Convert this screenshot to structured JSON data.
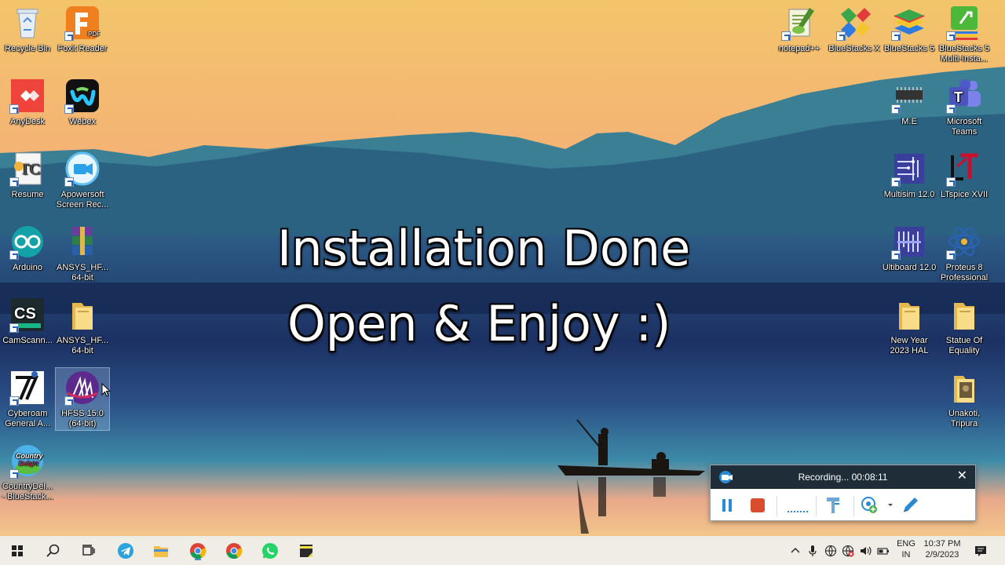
{
  "desktop": {
    "left_icons": [
      {
        "label": "Recycle Bin",
        "icon": "recycle-bin-icon"
      },
      {
        "label": "Foxit Reader",
        "icon": "foxit-reader-icon"
      },
      {
        "label": "AnyDesk",
        "icon": "anydesk-icon"
      },
      {
        "label": "Webex",
        "icon": "webex-icon"
      },
      {
        "label": "Resume",
        "icon": "resume-document-icon"
      },
      {
        "label": "Apowersoft Screen Rec...",
        "icon": "apowersoft-icon"
      },
      {
        "label": "Arduino",
        "icon": "arduino-icon"
      },
      {
        "label": "ANSYS_HF... 64-bit",
        "icon": "winrar-archive-icon"
      },
      {
        "label": "CamScann...",
        "icon": "camscanner-icon"
      },
      {
        "label": "ANSYS_HF... 64-bit",
        "icon": "folder-icon"
      },
      {
        "label": "Cyberoam General A...",
        "icon": "cyberoam-icon"
      },
      {
        "label": "HFSS 15.0 (64-bit)",
        "icon": "hfss-icon"
      },
      {
        "label": "CountryDel... - BlueStack...",
        "icon": "country-delight-icon"
      }
    ],
    "right_icons": [
      {
        "label": "notepad++",
        "icon": "notepad-plus-plus-icon"
      },
      {
        "label": "BlueStacks X",
        "icon": "bluestacks-x-icon"
      },
      {
        "label": "BlueStacks 5",
        "icon": "bluestacks-5-icon"
      },
      {
        "label": "BlueStacks 5 Multi-Insta...",
        "icon": "bluestacks-multi-instance-icon"
      },
      {
        "label": "M.E",
        "icon": "chip-icon"
      },
      {
        "label": "Microsoft Teams",
        "icon": "microsoft-teams-icon"
      },
      {
        "label": "Multisim 12.0",
        "icon": "multisim-icon"
      },
      {
        "label": "LTspice XVII",
        "icon": "ltspice-icon"
      },
      {
        "label": "Ultiboard 12.0",
        "icon": "ultiboard-icon"
      },
      {
        "label": "Proteus 8 Professional",
        "icon": "proteus-icon"
      },
      {
        "label": "New Year 2023 HAL",
        "icon": "folder-icon"
      },
      {
        "label": "Statue Of Equality",
        "icon": "folder-icon"
      },
      {
        "label": "Unakoti, Tripura",
        "icon": "folder-image-icon"
      }
    ]
  },
  "overlay": {
    "line1": "Installation Done",
    "line2": "Open & Enjoy :)"
  },
  "recorder": {
    "status": "Recording... 00:08:11",
    "close_icon": "close-icon",
    "tools": [
      "pause-icon",
      "stop-icon",
      "dotted-line-icon",
      "paint-tool-icon",
      "webcam-add-icon",
      "dropdown-icon",
      "pen-icon"
    ]
  },
  "taskbar": {
    "apps": [
      "windows-start-icon",
      "search-icon",
      "task-view-icon",
      "telegram-icon",
      "file-explorer-icon",
      "chrome-icon",
      "chrome-icon",
      "whatsapp-icon",
      "sticky-notes-icon"
    ],
    "tray_icons": [
      "chevron-up-icon",
      "microphone-icon",
      "network-icon",
      "globe-icon",
      "volume-icon",
      "battery-icon"
    ],
    "language_line1": "ENG",
    "language_line2": "IN",
    "time": "10:37 PM",
    "date": "2/9/2023",
    "notification_icon": "notification-icon"
  },
  "colors": {
    "sky_top": "#f2c56a",
    "sky_mid": "#f59a7e",
    "mountain": "#2f6f86",
    "water_band": "#203a68",
    "taskbar": "#f0ede6",
    "recorder_header": "#1e2d38",
    "recorder_accent": "#2a8ad6",
    "stop_red": "#d94c2e"
  }
}
